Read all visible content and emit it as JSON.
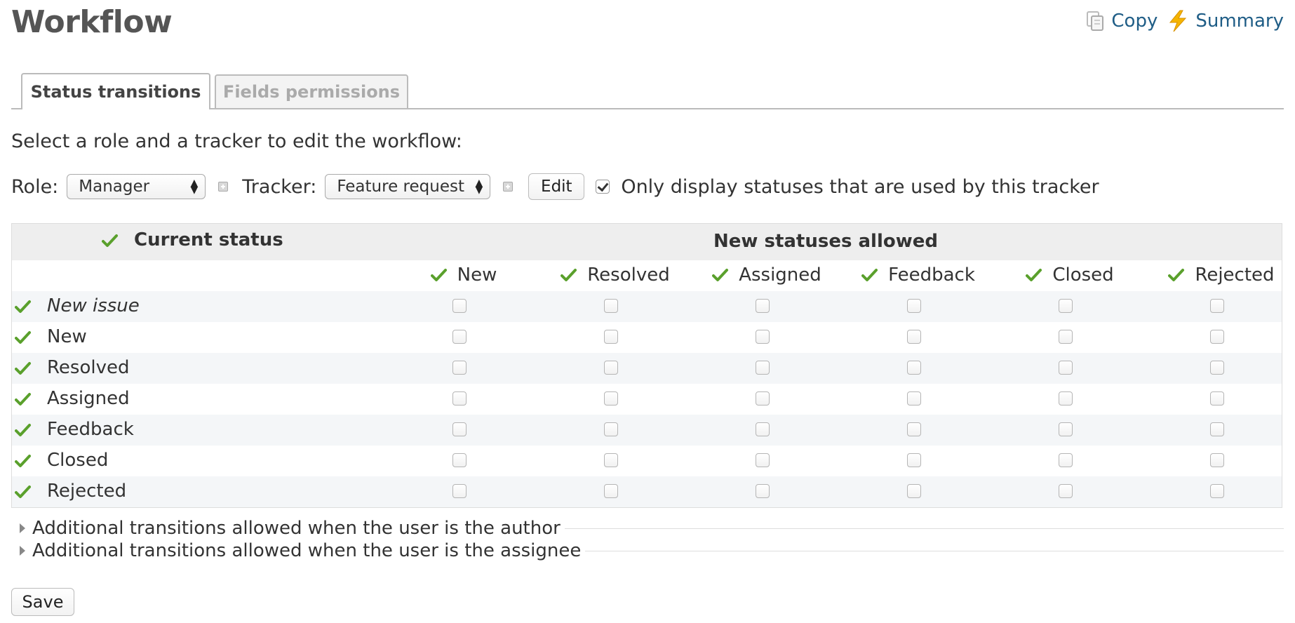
{
  "page": {
    "title": "Workflow"
  },
  "actions": {
    "copy_label": "Copy",
    "summary_label": "Summary"
  },
  "tabs": [
    {
      "label": "Status transitions",
      "active": true
    },
    {
      "label": "Fields permissions",
      "active": false
    }
  ],
  "instructions": "Select a role and a tracker to edit the workflow:",
  "filters": {
    "role_label": "Role:",
    "role_value": "Manager",
    "tracker_label": "Tracker:",
    "tracker_value": "Feature request",
    "edit_label": "Edit",
    "only_used_label": "Only display statuses that are used by this tracker",
    "only_used_checked": true
  },
  "table": {
    "current_status_header": "Current status",
    "new_statuses_header": "New statuses allowed",
    "columns": [
      "New",
      "Resolved",
      "Assigned",
      "Feedback",
      "Closed",
      "Rejected"
    ],
    "rows": [
      {
        "label": "New issue",
        "italic": true
      },
      {
        "label": "New",
        "italic": false
      },
      {
        "label": "Resolved",
        "italic": false
      },
      {
        "label": "Assigned",
        "italic": false
      },
      {
        "label": "Feedback",
        "italic": false
      },
      {
        "label": "Closed",
        "italic": false
      },
      {
        "label": "Rejected",
        "italic": false
      }
    ]
  },
  "collapsibles": [
    "Additional transitions allowed when the user is the author",
    "Additional transitions allowed when the user is the assignee"
  ],
  "save_label": "Save",
  "colors": {
    "link": "#1f5d86",
    "check_green": "#5aa02c",
    "row_alt": "#f4f6f8",
    "header_bg": "#eeeeee"
  }
}
